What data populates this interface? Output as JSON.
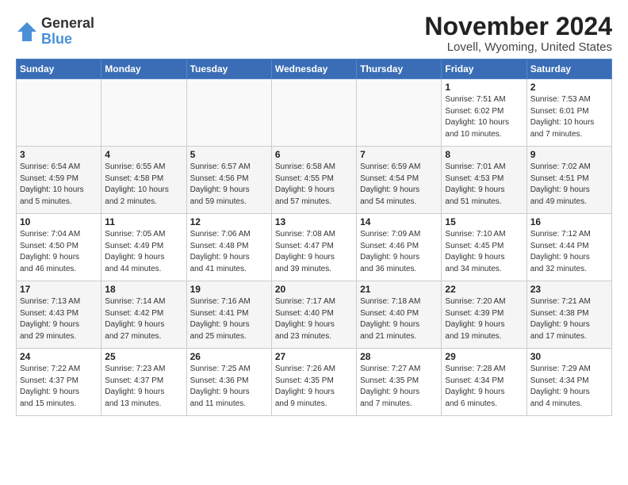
{
  "logo": {
    "general": "General",
    "blue": "Blue"
  },
  "title": "November 2024",
  "location": "Lovell, Wyoming, United States",
  "weekdays": [
    "Sunday",
    "Monday",
    "Tuesday",
    "Wednesday",
    "Thursday",
    "Friday",
    "Saturday"
  ],
  "rows": [
    [
      {
        "day": "",
        "info": ""
      },
      {
        "day": "",
        "info": ""
      },
      {
        "day": "",
        "info": ""
      },
      {
        "day": "",
        "info": ""
      },
      {
        "day": "",
        "info": ""
      },
      {
        "day": "1",
        "info": "Sunrise: 7:51 AM\nSunset: 6:02 PM\nDaylight: 10 hours\nand 10 minutes."
      },
      {
        "day": "2",
        "info": "Sunrise: 7:53 AM\nSunset: 6:01 PM\nDaylight: 10 hours\nand 7 minutes."
      }
    ],
    [
      {
        "day": "3",
        "info": "Sunrise: 6:54 AM\nSunset: 4:59 PM\nDaylight: 10 hours\nand 5 minutes."
      },
      {
        "day": "4",
        "info": "Sunrise: 6:55 AM\nSunset: 4:58 PM\nDaylight: 10 hours\nand 2 minutes."
      },
      {
        "day": "5",
        "info": "Sunrise: 6:57 AM\nSunset: 4:56 PM\nDaylight: 9 hours\nand 59 minutes."
      },
      {
        "day": "6",
        "info": "Sunrise: 6:58 AM\nSunset: 4:55 PM\nDaylight: 9 hours\nand 57 minutes."
      },
      {
        "day": "7",
        "info": "Sunrise: 6:59 AM\nSunset: 4:54 PM\nDaylight: 9 hours\nand 54 minutes."
      },
      {
        "day": "8",
        "info": "Sunrise: 7:01 AM\nSunset: 4:53 PM\nDaylight: 9 hours\nand 51 minutes."
      },
      {
        "day": "9",
        "info": "Sunrise: 7:02 AM\nSunset: 4:51 PM\nDaylight: 9 hours\nand 49 minutes."
      }
    ],
    [
      {
        "day": "10",
        "info": "Sunrise: 7:04 AM\nSunset: 4:50 PM\nDaylight: 9 hours\nand 46 minutes."
      },
      {
        "day": "11",
        "info": "Sunrise: 7:05 AM\nSunset: 4:49 PM\nDaylight: 9 hours\nand 44 minutes."
      },
      {
        "day": "12",
        "info": "Sunrise: 7:06 AM\nSunset: 4:48 PM\nDaylight: 9 hours\nand 41 minutes."
      },
      {
        "day": "13",
        "info": "Sunrise: 7:08 AM\nSunset: 4:47 PM\nDaylight: 9 hours\nand 39 minutes."
      },
      {
        "day": "14",
        "info": "Sunrise: 7:09 AM\nSunset: 4:46 PM\nDaylight: 9 hours\nand 36 minutes."
      },
      {
        "day": "15",
        "info": "Sunrise: 7:10 AM\nSunset: 4:45 PM\nDaylight: 9 hours\nand 34 minutes."
      },
      {
        "day": "16",
        "info": "Sunrise: 7:12 AM\nSunset: 4:44 PM\nDaylight: 9 hours\nand 32 minutes."
      }
    ],
    [
      {
        "day": "17",
        "info": "Sunrise: 7:13 AM\nSunset: 4:43 PM\nDaylight: 9 hours\nand 29 minutes."
      },
      {
        "day": "18",
        "info": "Sunrise: 7:14 AM\nSunset: 4:42 PM\nDaylight: 9 hours\nand 27 minutes."
      },
      {
        "day": "19",
        "info": "Sunrise: 7:16 AM\nSunset: 4:41 PM\nDaylight: 9 hours\nand 25 minutes."
      },
      {
        "day": "20",
        "info": "Sunrise: 7:17 AM\nSunset: 4:40 PM\nDaylight: 9 hours\nand 23 minutes."
      },
      {
        "day": "21",
        "info": "Sunrise: 7:18 AM\nSunset: 4:40 PM\nDaylight: 9 hours\nand 21 minutes."
      },
      {
        "day": "22",
        "info": "Sunrise: 7:20 AM\nSunset: 4:39 PM\nDaylight: 9 hours\nand 19 minutes."
      },
      {
        "day": "23",
        "info": "Sunrise: 7:21 AM\nSunset: 4:38 PM\nDaylight: 9 hours\nand 17 minutes."
      }
    ],
    [
      {
        "day": "24",
        "info": "Sunrise: 7:22 AM\nSunset: 4:37 PM\nDaylight: 9 hours\nand 15 minutes."
      },
      {
        "day": "25",
        "info": "Sunrise: 7:23 AM\nSunset: 4:37 PM\nDaylight: 9 hours\nand 13 minutes."
      },
      {
        "day": "26",
        "info": "Sunrise: 7:25 AM\nSunset: 4:36 PM\nDaylight: 9 hours\nand 11 minutes."
      },
      {
        "day": "27",
        "info": "Sunrise: 7:26 AM\nSunset: 4:35 PM\nDaylight: 9 hours\nand 9 minutes."
      },
      {
        "day": "28",
        "info": "Sunrise: 7:27 AM\nSunset: 4:35 PM\nDaylight: 9 hours\nand 7 minutes."
      },
      {
        "day": "29",
        "info": "Sunrise: 7:28 AM\nSunset: 4:34 PM\nDaylight: 9 hours\nand 6 minutes."
      },
      {
        "day": "30",
        "info": "Sunrise: 7:29 AM\nSunset: 4:34 PM\nDaylight: 9 hours\nand 4 minutes."
      }
    ]
  ]
}
